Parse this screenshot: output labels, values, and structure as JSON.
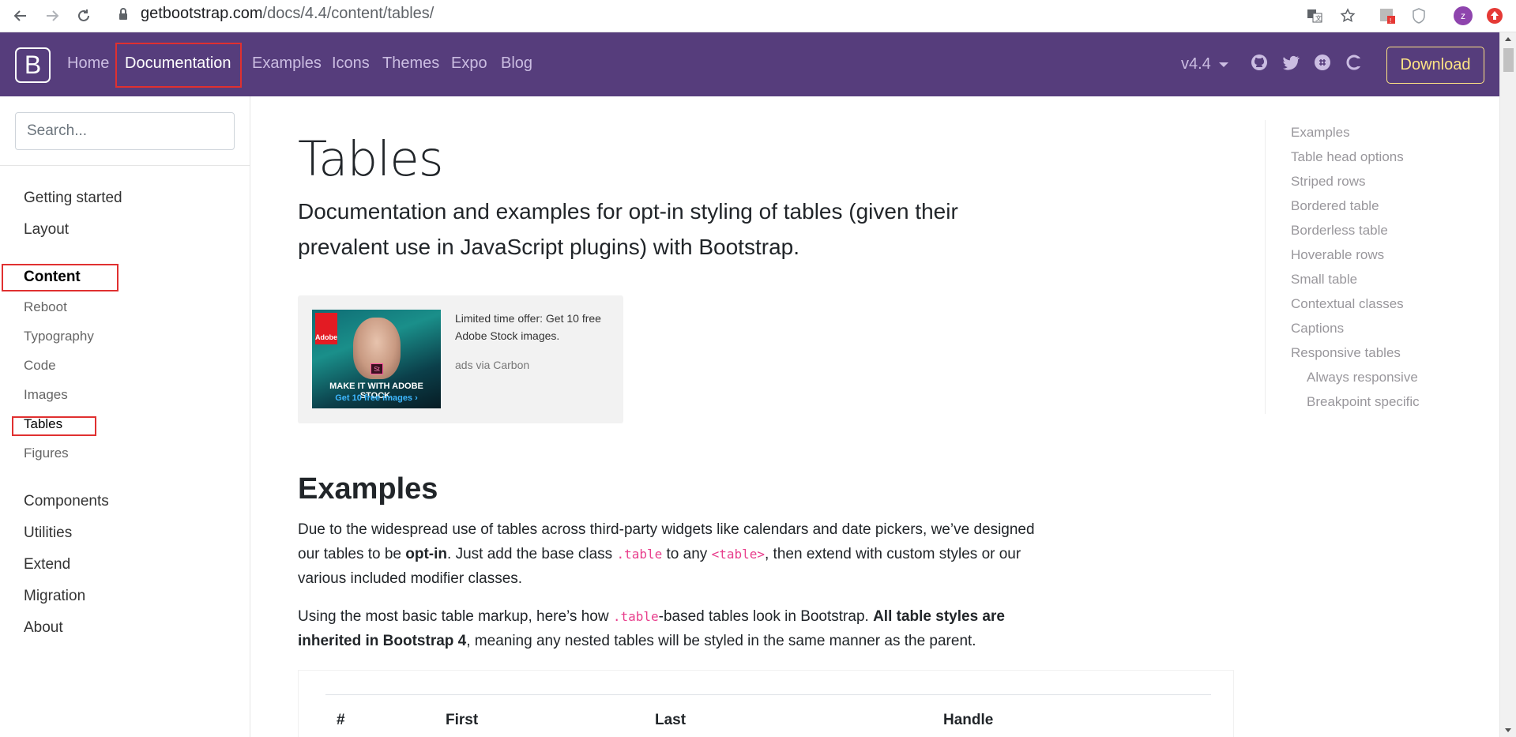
{
  "browser": {
    "url_host": "getbootstrap.com",
    "url_path": "/docs/4.4/content/tables/",
    "profile_initial": "z"
  },
  "navbar": {
    "brand": "B",
    "links": [
      "Home",
      "Documentation",
      "Examples",
      "Icons",
      "Themes",
      "Expo",
      "Blog"
    ],
    "active": "Documentation",
    "version": "v4.4",
    "download_label": "Download"
  },
  "sidebar": {
    "search_placeholder": "Search...",
    "groups_top": [
      "Getting started",
      "Layout"
    ],
    "content_group": "Content",
    "content_items": [
      "Reboot",
      "Typography",
      "Code",
      "Images",
      "Tables",
      "Figures"
    ],
    "groups_bottom": [
      "Components",
      "Utilities",
      "Extend",
      "Migration",
      "About"
    ]
  },
  "main": {
    "title": "Tables",
    "lead": "Documentation and examples for opt-in styling of tables (given their prevalent use in JavaScript plugins) with Bootstrap.",
    "ad": {
      "brand": "Adobe",
      "badge": "St",
      "image_line1": "MAKE IT WITH ADOBE STOCK.",
      "image_line2": "Get 10 free images ›",
      "text": "Limited time offer: Get 10 free Adobe Stock images.",
      "via": "ads via Carbon"
    },
    "examples_heading": "Examples",
    "para1": {
      "t1": "Due to the widespread use of tables across third-party widgets like calendars and date pickers, we’ve designed our tables to be ",
      "bold": "opt-in",
      "t2": ". Just add the base class ",
      "code1": ".table",
      "t3": " to any ",
      "code2": "<table>",
      "t4": ", then extend with custom styles or our various included modifier classes."
    },
    "para2": {
      "t1": "Using the most basic table markup, here’s how ",
      "code1": ".table",
      "t2": "-based tables look in Bootstrap. ",
      "bold": "All table styles are inherited in Bootstrap 4",
      "t3": ", meaning any nested tables will be styled in the same manner as the parent."
    },
    "table_headers": [
      "#",
      "First",
      "Last",
      "Handle"
    ]
  },
  "toc": {
    "items": [
      "Examples",
      "Table head options",
      "Striped rows",
      "Bordered table",
      "Borderless table",
      "Hoverable rows",
      "Small table",
      "Contextual classes",
      "Captions",
      "Responsive tables"
    ],
    "sub_items": [
      "Always responsive",
      "Breakpoint specific"
    ]
  },
  "colors": {
    "navbar": "#563d7c",
    "nav_link": "#cbbde2",
    "download": "#ffe484",
    "highlight_box": "#e03030",
    "code": "#e83e8c"
  }
}
